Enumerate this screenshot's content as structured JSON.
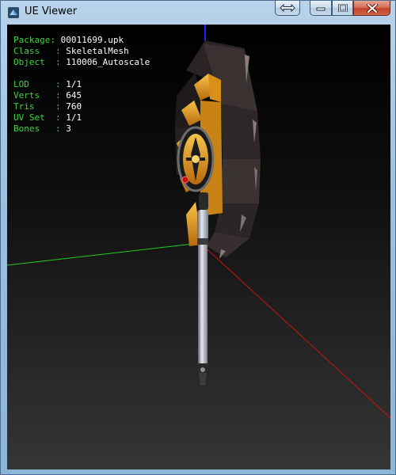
{
  "window": {
    "title": "UE Viewer"
  },
  "info": {
    "package_key": "Package: ",
    "package": "00011699.upk",
    "class_key": "Class   : ",
    "class": "SkeletalMesh",
    "object_key": "Object  : ",
    "object": "110006_Autoscale",
    "lod_key": "LOD     : ",
    "lod": "1/1",
    "verts_key": "Verts   : ",
    "verts": "645",
    "tris_key": "Tris    : ",
    "tris": "760",
    "uvset_key": "UV Set  : ",
    "uvset": "1/1",
    "bones_key": "Bones   : ",
    "bones": "3"
  },
  "colors": {
    "info_key": "#3fd43f",
    "info_value": "#ffffff",
    "axis_x": "#cc1111",
    "axis_y": "#22cc22",
    "axis_z": "#2222ee",
    "viewport_bg_top": "#000000",
    "viewport_bg_bottom": "#353535",
    "titlebar": "#b8d3ea",
    "close_button": "#c1432a"
  },
  "icons": {
    "app": "ue-viewer-app-icon",
    "resize": "double-arrow-icon",
    "minimize": "minimize-icon",
    "maximize": "maximize-icon",
    "close": "close-icon"
  }
}
